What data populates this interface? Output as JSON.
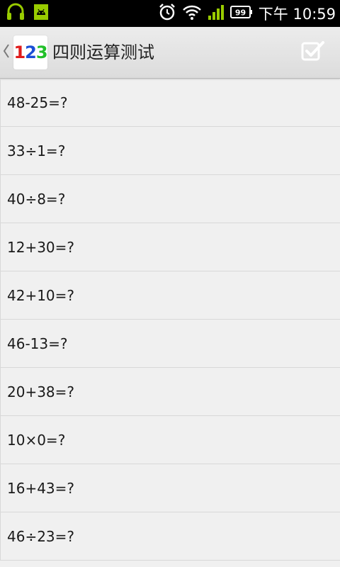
{
  "status_bar": {
    "time": "下午 10:59",
    "battery_level": "99",
    "icons": [
      "headset-icon",
      "android-debug-icon",
      "alarm-icon",
      "wifi-icon",
      "signal-icon",
      "battery-icon"
    ]
  },
  "app_bar": {
    "icon_digits": [
      "1",
      "2",
      "3"
    ],
    "title": "四则运算测试",
    "submit_icon": "checkbox-check-icon"
  },
  "questions": [
    "48-25=?",
    "33÷1=?",
    "40÷8=?",
    "12+30=?",
    "42+10=?",
    "46-13=?",
    "20+38=?",
    "10×0=?",
    "16+43=?",
    "46÷23=?"
  ],
  "colors": {
    "status_bar_bg": "#000000",
    "app_bar_bg": "#e4e4e4",
    "list_bg": "#f0f0f0",
    "icon_digit_1": "#e01b1b",
    "icon_digit_2": "#1a4fd6",
    "icon_digit_3": "#22c02a",
    "status_icon_green": "#99cc00"
  }
}
